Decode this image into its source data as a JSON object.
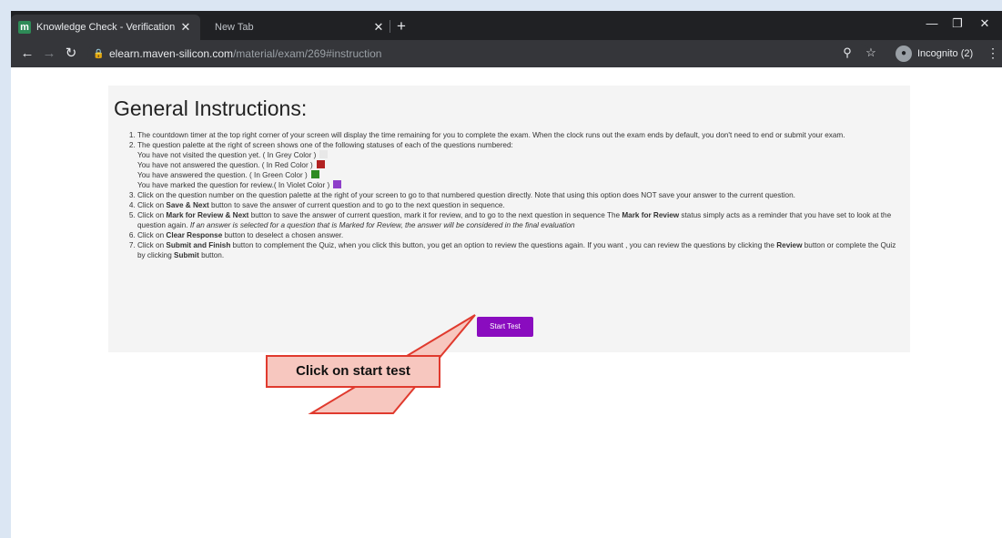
{
  "browser": {
    "tabs": [
      {
        "title": "Knowledge Check - Verification I",
        "favicon": "m"
      },
      {
        "title": "New Tab"
      }
    ],
    "url_host": "elearn.maven-silicon.com",
    "url_path": "/material/exam/269#instruction",
    "profile_label": "Incognito (2)"
  },
  "page": {
    "heading": "General Instructions:",
    "items": {
      "i1": "The countdown timer at the top right corner of your screen will display the time remaining for you to complete the exam. When the clock runs out the exam ends by default, you don't need to end or submit your exam.",
      "i2": "The question palette at the right of screen shows one of the following statuses of each of the questions numbered:",
      "status1": "You have not visited the question yet. ( In Grey Color )",
      "status2": "You have not answered the question. ( In Red Color )",
      "status3": "You have answered the question. ( In Green Color )",
      "status4": "You have marked the question for review.( In Violet Color )",
      "i3": "Click on the question number on the question palette at the right of your screen to go to that numbered question directly. Note that using this option does NOT save your answer to the current question.",
      "i4_pre": "Click on ",
      "i4_bold": "Save & Next",
      "i4_post": " button to save the answer of current question and to go to the next question in sequence.",
      "i5_pre": "Click on ",
      "i5_bold": "Mark for Review & Next",
      "i5_mid": " button to save the answer of current question, mark it for review, and to go to the next question in sequence The ",
      "i5_bold2": "Mark for Review",
      "i5_mid2": " status simply acts as a reminder that you have set to look at the question again. ",
      "i5_italic": "If an answer is selected for a question that is Marked for Review, the answer will be considered in the final evaluation",
      "i6_pre": "Click on ",
      "i6_bold": "Clear Response",
      "i6_post": " button to deselect a chosen answer.",
      "i7_pre": "Click on ",
      "i7_bold": "Submit and Finish",
      "i7_mid": " button to complement the Quiz, when you click this button, you get an option to review the questions again. If you want , you can review the questions by clicking the ",
      "i7_bold2": "Review",
      "i7_mid2": " button or complete the Quiz by clicking ",
      "i7_bold3": "Submit",
      "i7_post": " button."
    },
    "status_colors": {
      "grey": "#e8e8e8",
      "red": "#b22222",
      "green": "#2e8b22",
      "violet": "#8e3fc9"
    },
    "start_button": "Start Test"
  },
  "annotation": {
    "callout_text": "Click on start test"
  }
}
